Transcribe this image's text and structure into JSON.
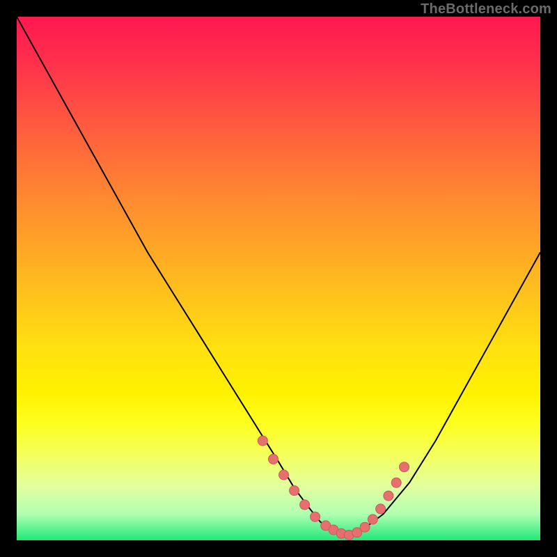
{
  "watermark": "TheBottleneck.com",
  "colors": {
    "curve_stroke": "#000000",
    "dot_fill": "#e76f6f",
    "dot_stroke": "#c95a5a"
  },
  "chart_data": {
    "type": "line",
    "title": "",
    "xlabel": "",
    "ylabel": "",
    "xlim": [
      0,
      100
    ],
    "ylim": [
      0,
      100
    ],
    "grid": false,
    "series": [
      {
        "name": "bottleneck-curve",
        "x": [
          0,
          5,
          10,
          15,
          20,
          25,
          30,
          35,
          40,
          45,
          50,
          53,
          56,
          58,
          60,
          62,
          64,
          66,
          70,
          75,
          80,
          85,
          90,
          95,
          100
        ],
        "y": [
          100,
          91,
          82,
          73,
          64,
          55,
          47,
          39,
          31,
          23,
          15,
          10,
          6,
          3.5,
          2,
          1.2,
          1,
          2,
          5,
          11,
          19,
          28,
          37,
          46,
          55
        ]
      }
    ],
    "annotations": {
      "dots": {
        "description": "highlighted points near curve minimum",
        "x": [
          47,
          49,
          51,
          53,
          55,
          57,
          59,
          60.5,
          62,
          63.5,
          65,
          66.5,
          68,
          69.5,
          71,
          72.5,
          74
        ],
        "y": [
          19,
          15.5,
          12.5,
          9.5,
          6.8,
          4.5,
          2.8,
          2,
          1.3,
          1,
          1.5,
          2.5,
          4,
          6,
          8.5,
          11,
          14
        ]
      }
    }
  }
}
